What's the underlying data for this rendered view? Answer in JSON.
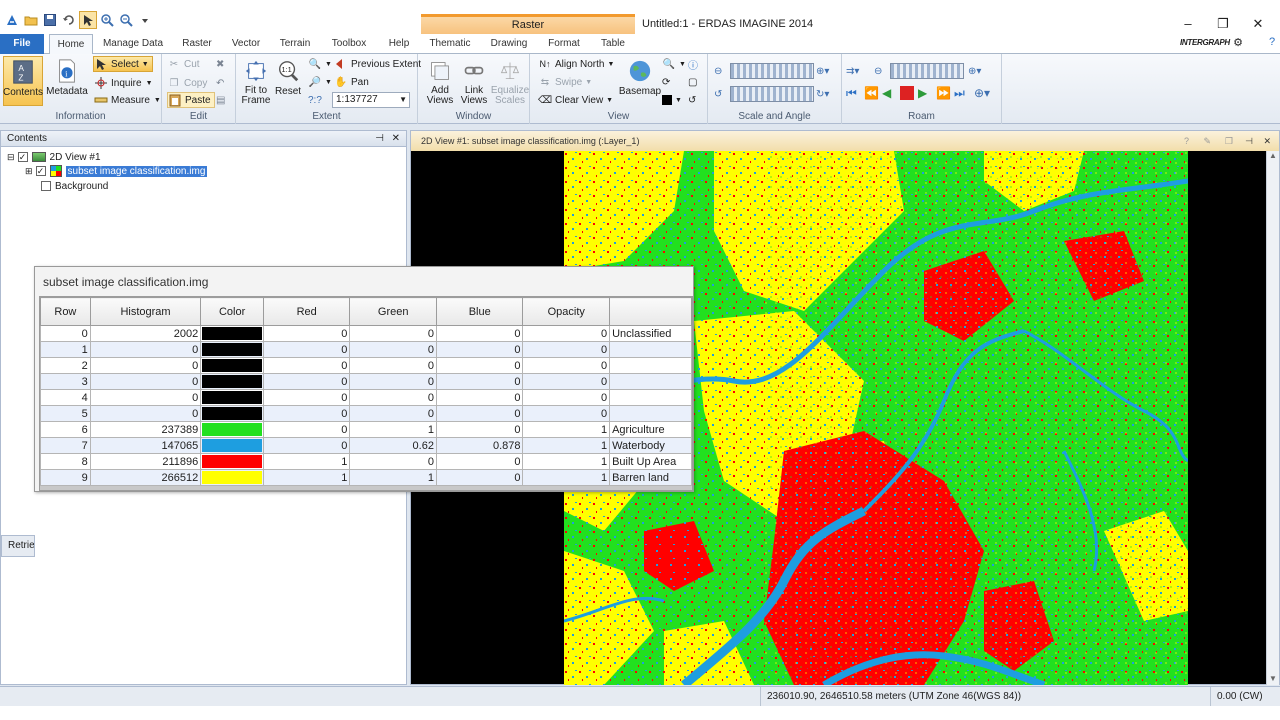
{
  "app": {
    "title": "Untitled:1 - ERDAS IMAGINE 2014",
    "context_tab": "Raster",
    "brand": "INTERGRAPH"
  },
  "tabs": {
    "file": "File",
    "home": "Home",
    "manage_data": "Manage Data",
    "raster": "Raster",
    "vector": "Vector",
    "terrain": "Terrain",
    "toolbox": "Toolbox",
    "help": "Help",
    "thematic": "Thematic",
    "drawing": "Drawing",
    "format": "Format",
    "table": "Table"
  },
  "ribbon": {
    "information": {
      "label": "Information",
      "contents": "Contents",
      "metadata": "Metadata"
    },
    "select": {
      "select": "Select",
      "inquire": "Inquire",
      "measure": "Measure"
    },
    "edit": {
      "label": "Edit",
      "cut": "Cut",
      "copy": "Copy",
      "paste": "Paste"
    },
    "extent": {
      "label": "Extent",
      "fit_to_frame": "Fit to\nFrame",
      "reset": "Reset",
      "previous_extent": "Previous Extent",
      "pan": "Pan",
      "scale": "1:137727"
    },
    "window": {
      "label": "Window",
      "add_views": "Add\nViews",
      "link_views": "Link\nViews",
      "equalize_scales": "Equalize\nScales"
    },
    "view": {
      "label": "View",
      "align_north": "Align North",
      "swipe": "Swipe",
      "clear_view": "Clear View",
      "basemap": "Basemap"
    },
    "scale_angle": {
      "label": "Scale and Angle"
    },
    "roam": {
      "label": "Roam"
    }
  },
  "contents_panel": {
    "title": "Contents",
    "view_node": "2D View #1",
    "layer_node": "subset image classification.img",
    "background_node": "Background",
    "retrieve_tab": "Retrie"
  },
  "view_panel": {
    "title": "2D View #1: subset image classification.img (:Layer_1)"
  },
  "attribute_table": {
    "window_title": "subset image classification.img",
    "columns": [
      "Row",
      "Histogram",
      "Color",
      "Red",
      "Green",
      "Blue",
      "Opacity",
      ""
    ],
    "rows": [
      {
        "row": "0",
        "histogram": "2002",
        "color": "#000000",
        "red": "0",
        "green": "0",
        "blue": "0",
        "opacity": "0",
        "class_name": "Unclassified"
      },
      {
        "row": "1",
        "histogram": "0",
        "color": "#000000",
        "red": "0",
        "green": "0",
        "blue": "0",
        "opacity": "0",
        "class_name": ""
      },
      {
        "row": "2",
        "histogram": "0",
        "color": "#000000",
        "red": "0",
        "green": "0",
        "blue": "0",
        "opacity": "0",
        "class_name": ""
      },
      {
        "row": "3",
        "histogram": "0",
        "color": "#000000",
        "red": "0",
        "green": "0",
        "blue": "0",
        "opacity": "0",
        "class_name": ""
      },
      {
        "row": "4",
        "histogram": "0",
        "color": "#000000",
        "red": "0",
        "green": "0",
        "blue": "0",
        "opacity": "0",
        "class_name": ""
      },
      {
        "row": "5",
        "histogram": "0",
        "color": "#000000",
        "red": "0",
        "green": "0",
        "blue": "0",
        "opacity": "0",
        "class_name": ""
      },
      {
        "row": "6",
        "histogram": "237389",
        "color": "#22e01f",
        "red": "0",
        "green": "1",
        "blue": "0",
        "opacity": "1",
        "class_name": "Agriculture"
      },
      {
        "row": "7",
        "histogram": "147065",
        "color": "#1e9ee0",
        "red": "0",
        "green": "0.62",
        "blue": "0.878",
        "opacity": "1",
        "class_name": "Waterbody"
      },
      {
        "row": "8",
        "histogram": "211896",
        "color": "#ff0000",
        "red": "1",
        "green": "0",
        "blue": "0",
        "opacity": "1",
        "class_name": "Built Up Area"
      },
      {
        "row": "9",
        "histogram": "266512",
        "color": "#ffff00",
        "red": "1",
        "green": "1",
        "blue": "0",
        "opacity": "1",
        "class_name": "Barren land"
      }
    ]
  },
  "status_bar": {
    "coordinates": "236010.90, 2646510.58 meters (UTM Zone 46(WGS 84))",
    "rotation": "0.00 (CW)"
  },
  "colors": {
    "accent": "#2a6fc4",
    "agriculture": "#22e01f",
    "waterbody": "#1e9ee0",
    "built_up": "#ff0000",
    "barren": "#ffff00"
  }
}
